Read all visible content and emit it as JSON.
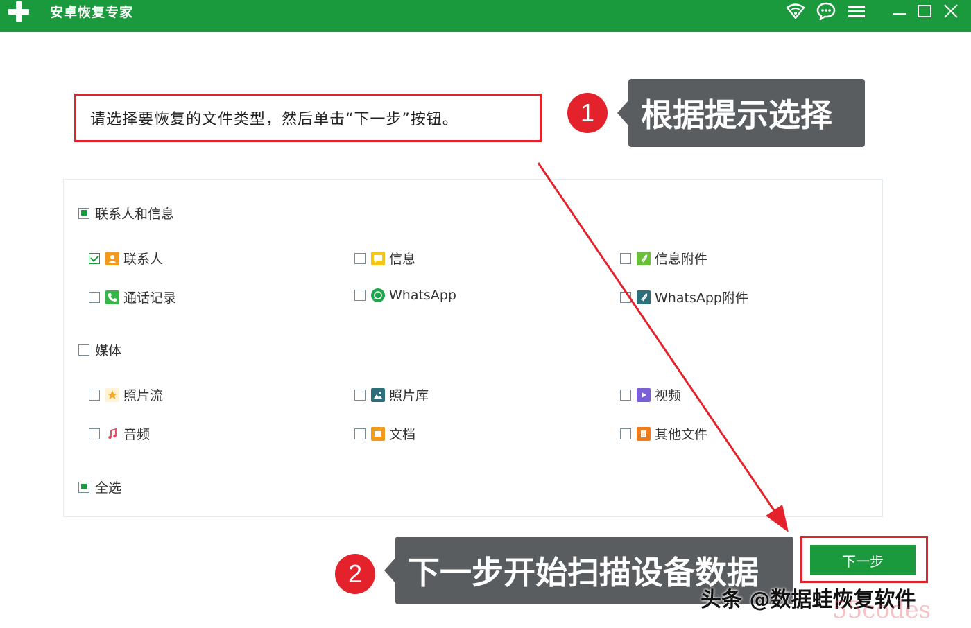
{
  "app": {
    "title": "安卓恢复专家"
  },
  "instruction": "请选择要恢复的文件类型，然后单击“下一步”按钮。",
  "annotations": {
    "step1_number": "1",
    "step1_text": "根据提示选择",
    "step2_number": "2",
    "step2_text": "下一步开始扫描设备数据"
  },
  "groups": {
    "contacts": {
      "label": "联系人和信息",
      "items": [
        {
          "label": "联系人",
          "checked": true,
          "icon": "contact-icon",
          "color": "#f29a1c"
        },
        {
          "label": "信息",
          "checked": false,
          "icon": "message-icon",
          "color": "#f5c518"
        },
        {
          "label": "信息附件",
          "checked": false,
          "icon": "attachment-icon",
          "color": "#6bbf3a"
        },
        {
          "label": "通话记录",
          "checked": false,
          "icon": "phone-icon",
          "color": "#38b54a"
        },
        {
          "label": "WhatsApp",
          "checked": false,
          "icon": "whatsapp-icon",
          "color": "#1fa64c"
        },
        {
          "label": "WhatsApp附件",
          "checked": false,
          "icon": "whatsapp-attachment-icon",
          "color": "#2c6e7a"
        }
      ]
    },
    "media": {
      "label": "媒体",
      "items": [
        {
          "label": "照片流",
          "checked": false,
          "icon": "photostream-icon",
          "color": "#f5a623"
        },
        {
          "label": "照片库",
          "checked": false,
          "icon": "gallery-icon",
          "color": "#2e6f7c"
        },
        {
          "label": "视频",
          "checked": false,
          "icon": "video-icon",
          "color": "#7b5fd6"
        },
        {
          "label": "音频",
          "checked": false,
          "icon": "audio-icon",
          "color": "#e0445a"
        },
        {
          "label": "文档",
          "checked": false,
          "icon": "document-icon",
          "color": "#f29a1c"
        },
        {
          "label": "其他文件",
          "checked": false,
          "icon": "other-file-icon",
          "color": "#f07c1c"
        }
      ]
    },
    "select_all": {
      "label": "全选"
    }
  },
  "next_button": {
    "label": "下一步"
  },
  "watermark": {
    "text": "头条 @数据蛙恢复软件",
    "text2": "55codes"
  },
  "colors": {
    "brand": "#1a9a3c",
    "highlight": "#e4222c",
    "callout": "#5a5d60"
  }
}
